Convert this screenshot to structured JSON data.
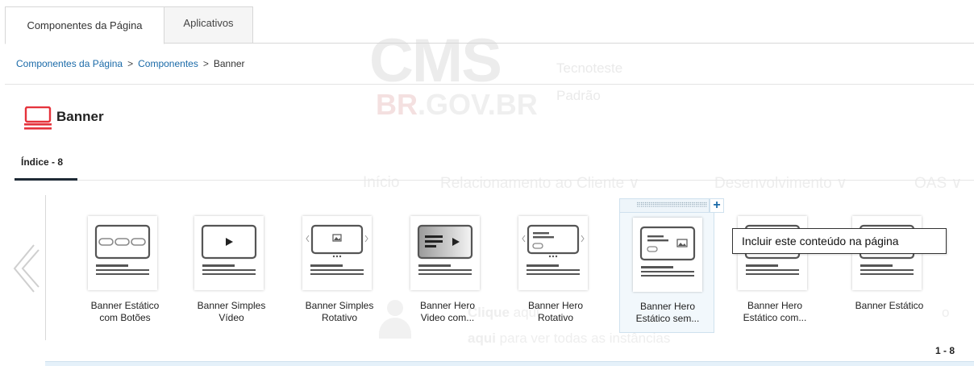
{
  "tabs": [
    {
      "label": "Componentes da Página",
      "active": true
    },
    {
      "label": "Aplicativos",
      "active": false
    }
  ],
  "breadcrumb": {
    "items": [
      "Componentes da Página",
      "Componentes"
    ],
    "current": "Banner",
    "separator": ">"
  },
  "title": "Banner",
  "subtab": {
    "label": "Índice - 8"
  },
  "cards": [
    {
      "line1": "Banner Estático",
      "line2": "com Botões",
      "icon": "banner-buttons-icon"
    },
    {
      "line1": "Banner Simples",
      "line2": "Vídeo",
      "icon": "banner-video-icon"
    },
    {
      "line1": "Banner Simples",
      "line2": "Rotativo",
      "icon": "banner-carousel-icon"
    },
    {
      "line1": "Banner Hero",
      "line2": "Video com...",
      "icon": "banner-hero-video-icon"
    },
    {
      "line1": "Banner Hero",
      "line2": "Rotativo",
      "icon": "banner-hero-carousel-icon"
    },
    {
      "line1": "Banner Hero",
      "line2": "Estático sem...",
      "icon": "banner-hero-static-icon"
    },
    {
      "line1": "Banner Hero",
      "line2": "Estático com...",
      "icon": "banner-hero-static-icon"
    },
    {
      "line1": "Banner Estático",
      "line2": "",
      "icon": "banner-static-icon"
    }
  ],
  "add_button": "+",
  "tooltip": "Incluir este conteúdo na página",
  "pager": "1 - 8",
  "background": {
    "logo": "CMS",
    "logo_sub": ".GOV.BR",
    "user_line1": "Tecnoteste",
    "user_line2": "Padrão",
    "nav": [
      "Início",
      "Relacionamento ao Cliente ∨",
      "Desenvolvimento ∨",
      "OAS ∨"
    ],
    "text1_bold": "Clique",
    "text1_rest": " aqui",
    "text2_bold": "aqui",
    "text2_rest": " para ver todas as instâncias",
    "text_right": "o"
  },
  "colors": {
    "link": "#1a6aa8",
    "title_icon": "#e5323b",
    "highlight_bg": "#f2f8fc",
    "highlight_border": "#cfe1ee"
  }
}
